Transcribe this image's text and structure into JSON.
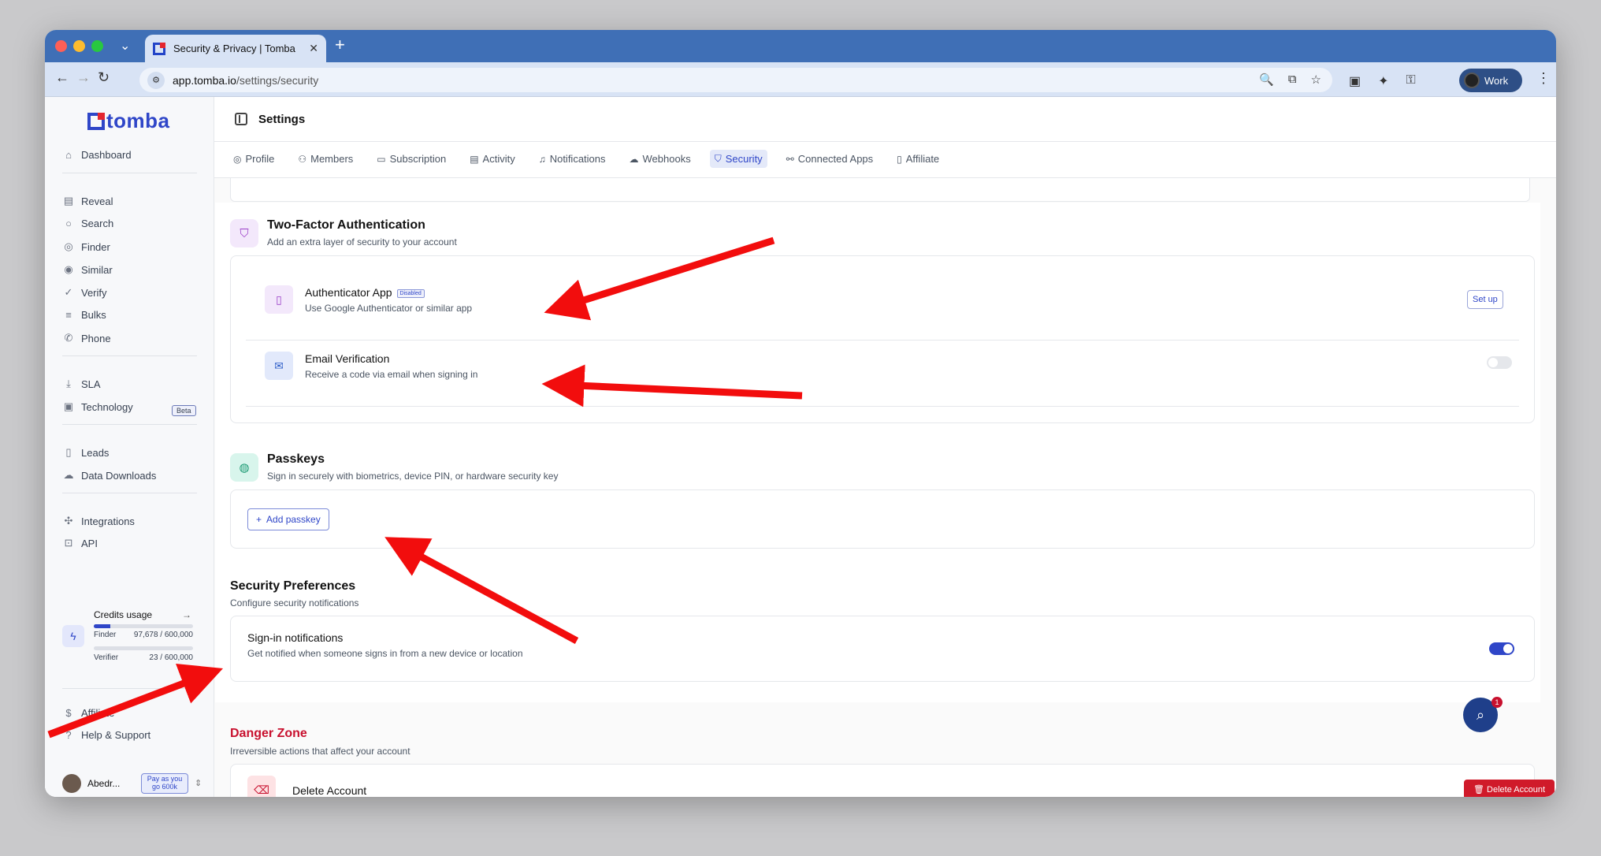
{
  "browser": {
    "tab_title": "Security & Privacy | Tomba",
    "url_host": "app.tomba.io",
    "url_path": "/settings/security",
    "profile_name": "Work"
  },
  "sidebar": {
    "logo_text": "tomba",
    "items": [
      {
        "label": "Dashboard",
        "icon": "home-icon"
      },
      {
        "label": "Reveal",
        "icon": "reveal-icon"
      },
      {
        "label": "Search",
        "icon": "search-icon"
      },
      {
        "label": "Finder",
        "icon": "finder-icon"
      },
      {
        "label": "Similar",
        "icon": "similar-icon"
      },
      {
        "label": "Verify",
        "icon": "verify-icon"
      },
      {
        "label": "Bulks",
        "icon": "bulks-icon"
      },
      {
        "label": "Phone",
        "icon": "phone-icon"
      },
      {
        "label": "SLA",
        "icon": "download-icon"
      },
      {
        "label": "Technology",
        "icon": "chip-icon"
      },
      {
        "label": "Leads",
        "icon": "leads-icon"
      },
      {
        "label": "Data Downloads",
        "icon": "cloud-icon"
      },
      {
        "label": "Integrations",
        "icon": "integrations-icon"
      },
      {
        "label": "API",
        "icon": "api-icon"
      },
      {
        "label": "Affiliate",
        "icon": "dollar-icon"
      },
      {
        "label": "Help & Support",
        "icon": "help-icon"
      }
    ],
    "beta_label": "Beta",
    "credits": {
      "title": "Credits usage",
      "finder_label": "Finder",
      "finder_value": "97,678 / 600,000",
      "finder_fraction": 0.163,
      "verifier_label": "Verifier",
      "verifier_value": "23 / 600,000",
      "verifier_fraction": 0.0
    },
    "user_name": "Abedr...",
    "plan_badge": "Pay as you go 600k"
  },
  "header": {
    "title": "Settings"
  },
  "settings_tabs": [
    {
      "label": "Profile",
      "active": false
    },
    {
      "label": "Members",
      "active": false
    },
    {
      "label": "Subscription",
      "active": false
    },
    {
      "label": "Activity",
      "active": false
    },
    {
      "label": "Notifications",
      "active": false
    },
    {
      "label": "Webhooks",
      "active": false
    },
    {
      "label": "Security",
      "active": true
    },
    {
      "label": "Connected Apps",
      "active": false
    },
    {
      "label": "Affiliate",
      "active": false
    }
  ],
  "two_factor": {
    "title": "Two-Factor Authentication",
    "subtitle": "Add an extra layer of security to your account",
    "authenticator": {
      "title": "Authenticator App",
      "badge": "Disabled",
      "subtitle": "Use Google Authenticator or similar app",
      "button": "Set up"
    },
    "email": {
      "title": "Email Verification",
      "subtitle": "Receive a code via email when signing in",
      "enabled": false
    }
  },
  "passkeys": {
    "title": "Passkeys",
    "subtitle": "Sign in securely with biometrics, device PIN, or hardware security key",
    "button": "Add passkey"
  },
  "preferences": {
    "title": "Security Preferences",
    "subtitle": "Configure security notifications",
    "signin": {
      "title": "Sign-in notifications",
      "subtitle": "Get notified when someone signs in from a new device or location",
      "enabled": true
    }
  },
  "danger": {
    "title": "Danger Zone",
    "subtitle": "Irreversible actions that affect your account",
    "delete_title": "Delete Account",
    "delete_button": "Delete Account"
  },
  "chat_badge": "1",
  "colors": {
    "accent": "#2f46c8",
    "danger": "#c8102e",
    "annotation_arrow": "#f20d0d"
  }
}
